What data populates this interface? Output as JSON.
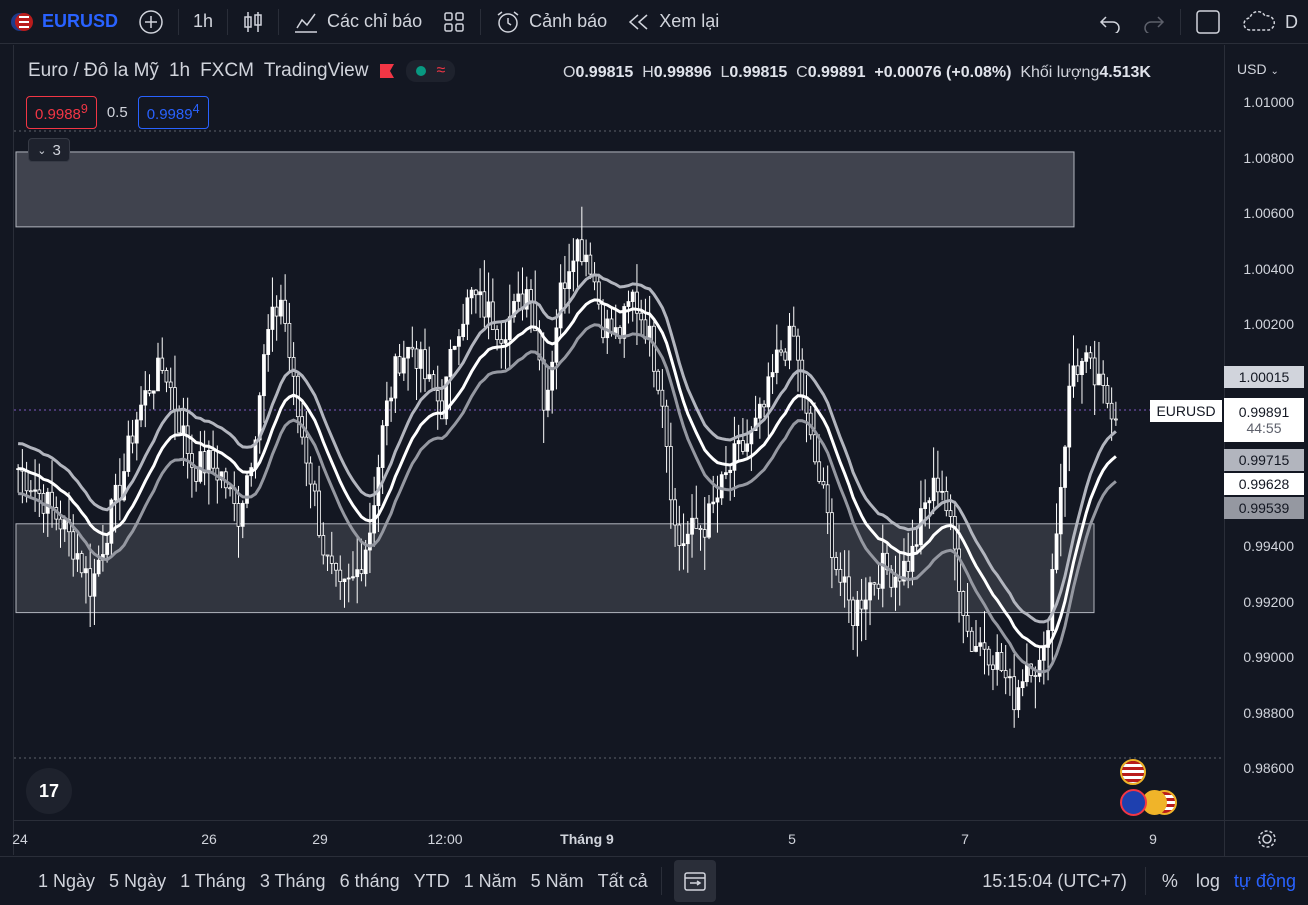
{
  "toolbar": {
    "symbol": "EURUSD",
    "interval": "1h",
    "indicators_label": "Các chỉ báo",
    "alert_label": "Cảnh báo",
    "replay_label": "Xem lại",
    "right_partial": "D"
  },
  "legend": {
    "title": "Euro / Đô la Mỹ",
    "interval": "1h",
    "exchange": "FXCM",
    "source": "TradingView",
    "o_label": "O",
    "o": "0.99815",
    "h_label": "H",
    "h": "0.99896",
    "l_label": "L",
    "l": "0.99815",
    "c_label": "C",
    "c": "0.99891",
    "change": "+0.00076 (+0.08%)",
    "volume_label": "Khối lượng",
    "volume": "4.513K"
  },
  "trade": {
    "sell_main": "0.9988",
    "sell_sup": "9",
    "spread": "0.5",
    "buy_main": "0.9989",
    "buy_sup": "4"
  },
  "indicators_count": "3",
  "price_axis": {
    "currency": "USD",
    "ticks": [
      "1.01000",
      "1.00800",
      "1.00600",
      "1.00400",
      "1.00200",
      "0.99400",
      "0.99200",
      "0.99000",
      "0.98800",
      "0.98600"
    ],
    "labels": {
      "upper": "1.00015",
      "symbol_tag": "EURUSD",
      "last": "0.99891",
      "countdown": "44:55",
      "band_up": "0.99715",
      "band_mid": "0.99628",
      "band_low": "0.99539"
    }
  },
  "time_axis": [
    "24",
    "26",
    "29",
    "12:00",
    "Tháng 9",
    "5",
    "7",
    "9"
  ],
  "bottom": {
    "ranges": [
      "1 Ngày",
      "5 Ngày",
      "1 Tháng",
      "3 Tháng",
      "6 tháng",
      "YTD",
      "1 Năm",
      "5 Năm",
      "Tất cả"
    ],
    "clock": "15:15:04 (UTC+7)",
    "percent": "%",
    "log": "log",
    "auto": "tự động"
  },
  "colors": {
    "background": "#131722",
    "accent": "#2962ff",
    "sell": "#f23645",
    "candle": "#ffffff",
    "zone": "#363a45"
  },
  "chart_data": {
    "type": "candlestick",
    "ylim": [
      0.9845,
      1.0115
    ],
    "zones": [
      {
        "from": 1.0055,
        "to": 1.0082
      },
      {
        "from": 0.9916,
        "to": 0.9948
      }
    ],
    "close_path": [
      0.9968,
      0.9962,
      0.9955,
      0.9948,
      0.9938,
      0.9925,
      0.9945,
      0.9962,
      0.9985,
      0.9998,
      1.0005,
      0.9985,
      0.9968,
      0.997,
      0.9965,
      0.995,
      0.9975,
      1.0015,
      1.003,
      0.999,
      0.9965,
      0.9935,
      0.9922,
      0.9928,
      0.9945,
      0.9985,
      1.0008,
      1.0012,
      0.9998,
      0.999,
      1.002,
      1.003,
      1.0025,
      1.0018,
      1.0025,
      1.0035,
      0.999,
      1.003,
      1.005,
      1.0045,
      1.002,
      1.0015,
      1.003,
      1.0018,
      0.9995,
      0.994,
      0.9945,
      0.9948,
      0.996,
      0.9972,
      0.9978,
      0.999,
      1.001,
      1.0015,
      0.998,
      0.9958,
      0.993,
      0.9915,
      0.9925,
      0.9932,
      0.993,
      0.9935,
      0.9955,
      0.9965,
      0.9938,
      0.9905,
      0.9905,
      0.9898,
      0.9885,
      0.99,
      0.9895,
      0.995,
      1.0005,
      1.0005,
      0.9995,
      0.9989
    ]
  }
}
